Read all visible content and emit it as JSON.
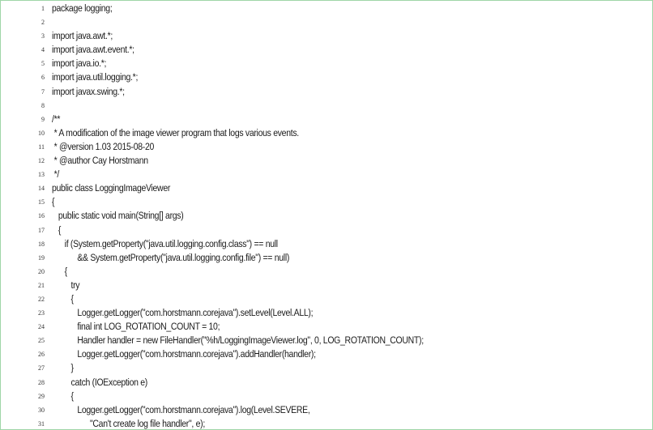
{
  "code": {
    "lines": [
      {
        "number": "1",
        "text": "package logging;"
      },
      {
        "number": "2",
        "text": ""
      },
      {
        "number": "3",
        "text": "import java.awt.*;"
      },
      {
        "number": "4",
        "text": "import java.awt.event.*;"
      },
      {
        "number": "5",
        "text": "import java.io.*;"
      },
      {
        "number": "6",
        "text": "import java.util.logging.*;"
      },
      {
        "number": "7",
        "text": "import javax.swing.*;"
      },
      {
        "number": "8",
        "text": ""
      },
      {
        "number": "9",
        "text": "/**"
      },
      {
        "number": "10",
        "text": " * A modification of the image viewer program that logs various events."
      },
      {
        "number": "11",
        "text": " * @version 1.03 2015-08-20"
      },
      {
        "number": "12",
        "text": " * @author Cay Horstmann"
      },
      {
        "number": "13",
        "text": " */"
      },
      {
        "number": "14",
        "text": "public class LoggingImageViewer"
      },
      {
        "number": "15",
        "text": "{"
      },
      {
        "number": "16",
        "text": "   public static void main(String[] args)"
      },
      {
        "number": "17",
        "text": "   {"
      },
      {
        "number": "18",
        "text": "      if (System.getProperty(\"java.util.logging.config.class\") == null"
      },
      {
        "number": "19",
        "text": "            && System.getProperty(\"java.util.logging.config.file\") == null)"
      },
      {
        "number": "20",
        "text": "      {"
      },
      {
        "number": "21",
        "text": "         try"
      },
      {
        "number": "22",
        "text": "         {"
      },
      {
        "number": "23",
        "text": "            Logger.getLogger(\"com.horstmann.corejava\").setLevel(Level.ALL);"
      },
      {
        "number": "24",
        "text": "            final int LOG_ROTATION_COUNT = 10;"
      },
      {
        "number": "25",
        "text": "            Handler handler = new FileHandler(\"%h/LoggingImageViewer.log\", 0, LOG_ROTATION_COUNT);"
      },
      {
        "number": "26",
        "text": "            Logger.getLogger(\"com.horstmann.corejava\").addHandler(handler);"
      },
      {
        "number": "27",
        "text": "         }"
      },
      {
        "number": "28",
        "text": "         catch (IOException e)"
      },
      {
        "number": "29",
        "text": "         {"
      },
      {
        "number": "30",
        "text": "            Logger.getLogger(\"com.horstmann.corejava\").log(Level.SEVERE,"
      },
      {
        "number": "31",
        "text": "                  \"Can't create log file handler\", e);"
      }
    ]
  }
}
